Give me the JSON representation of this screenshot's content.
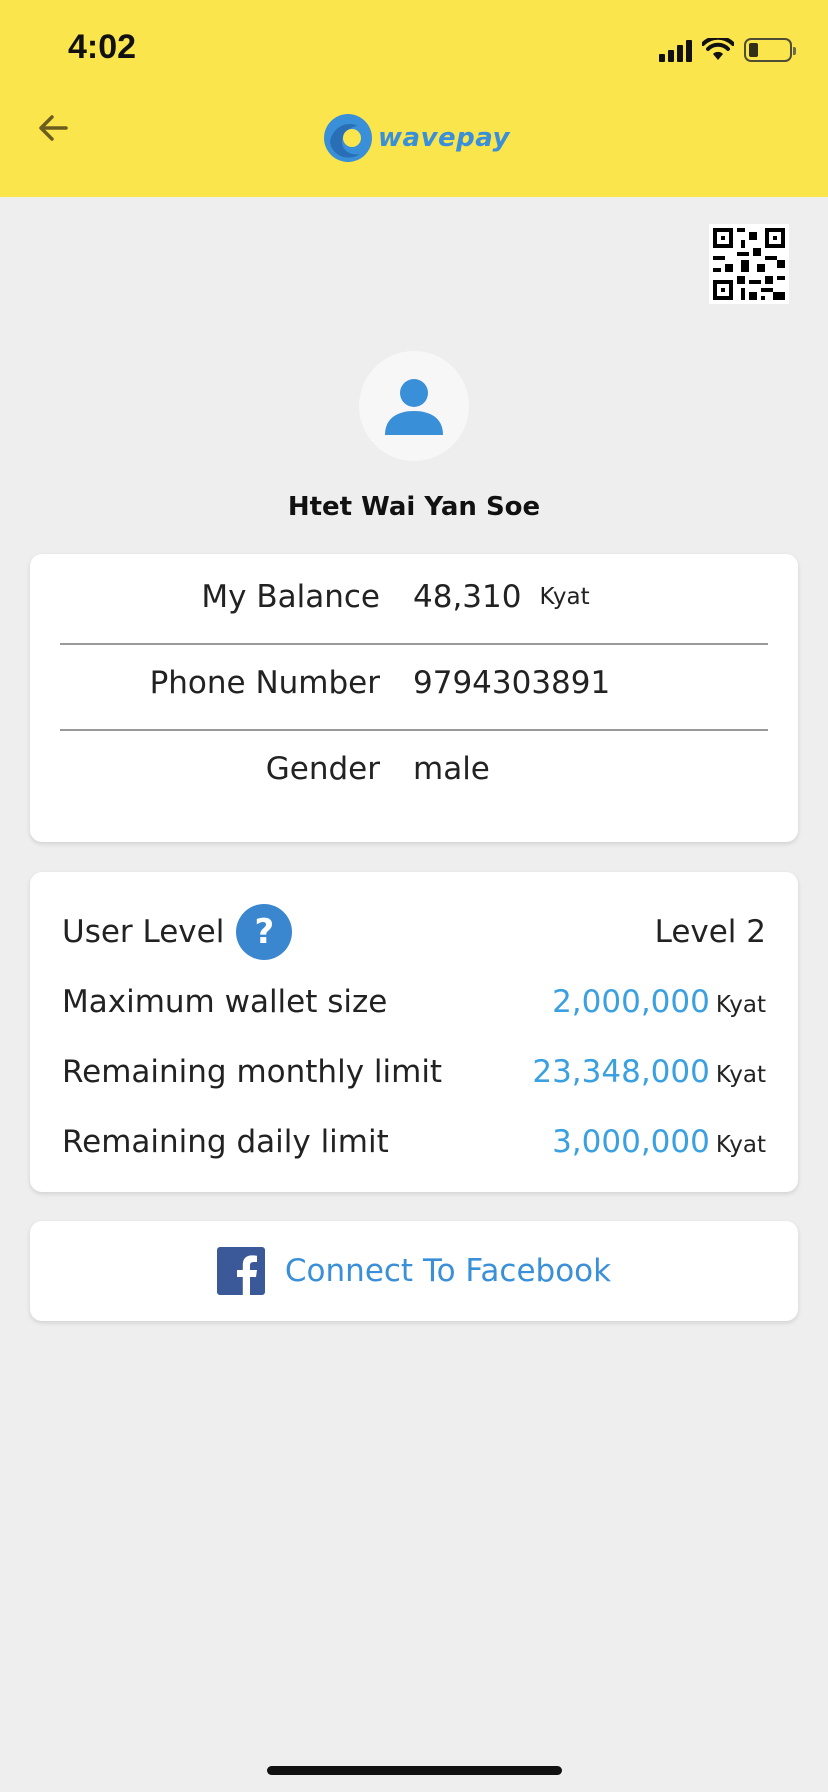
{
  "status_bar": {
    "time": "4:02"
  },
  "header": {
    "logo_text": "wavepay",
    "brand_color": "#fbe54d",
    "accent_color": "#3a8fd9"
  },
  "profile": {
    "name": "Htet Wai Yan Soe"
  },
  "account_info": {
    "balance_label": "My Balance",
    "balance_value": "48,310",
    "balance_unit": "Kyat",
    "phone_label": "Phone Number",
    "phone_value": "9794303891",
    "gender_label": "Gender",
    "gender_value": "male"
  },
  "limits": {
    "user_level_label": "User Level",
    "help_icon": "?",
    "user_level_value": "Level 2",
    "rows": [
      {
        "label": "Maximum wallet size",
        "value": "2,000,000",
        "unit": "Kyat"
      },
      {
        "label": "Remaining monthly limit",
        "value": "23,348,000",
        "unit": "Kyat"
      },
      {
        "label": "Remaining daily limit",
        "value": "3,000,000",
        "unit": "Kyat"
      }
    ]
  },
  "facebook": {
    "label": "Connect To Facebook",
    "color": "#3b5998"
  }
}
